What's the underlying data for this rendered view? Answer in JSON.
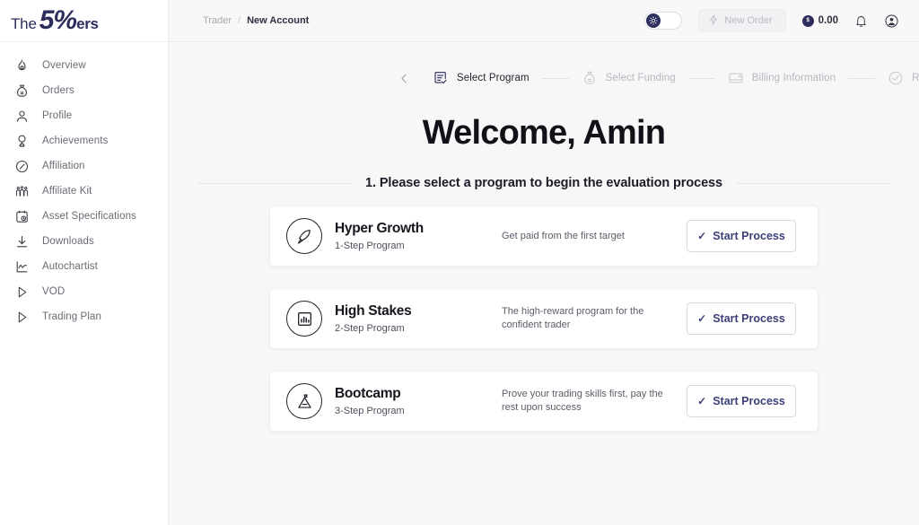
{
  "brand": {
    "logo_the": "The",
    "logo_five": "5%",
    "logo_ers": "ers",
    "navy": "#2b2d5c",
    "accent_button_text": "#3c3f78",
    "page_bg": "#f7f7f8",
    "card_bg": "#ffffff"
  },
  "sidebar": {
    "items": [
      {
        "label": "Overview",
        "icon": "flame-icon"
      },
      {
        "label": "Orders",
        "icon": "money-bag-icon"
      },
      {
        "label": "Profile",
        "icon": "user-icon"
      },
      {
        "label": "Achievements",
        "icon": "trophy-icon"
      },
      {
        "label": "Affiliation",
        "icon": "compass-icon"
      },
      {
        "label": "Affiliate Kit",
        "icon": "people-group-icon"
      },
      {
        "label": "Asset Specifications",
        "icon": "clipboard-clock-icon"
      },
      {
        "label": "Downloads",
        "icon": "download-icon"
      },
      {
        "label": "Autochartist",
        "icon": "chart-line-icon"
      },
      {
        "label": "VOD",
        "icon": "play-triangle-icon"
      },
      {
        "label": "Trading Plan",
        "icon": "play-triangle-icon"
      }
    ]
  },
  "topbar": {
    "breadcrumb_root": "Trader",
    "breadcrumb_separator": "/",
    "breadcrumb_current": "New Account",
    "theme_toggle_state": "light",
    "theme_toggle_icon": "sun-icon",
    "new_order_label": "New Order",
    "new_order_icon": "lightning-bolt-icon",
    "new_order_disabled": "true",
    "balance_icon": "coin-icon",
    "balance_icon_text": "$",
    "balance_amount": "0.00",
    "notifications_icon": "bell-icon",
    "account_icon": "user-circle-icon"
  },
  "stepper": {
    "back_icon": "chevron-left-icon",
    "steps": [
      {
        "label": "Select Program",
        "icon": "document-check-icon",
        "state": "active"
      },
      {
        "label": "Select Funding",
        "icon": "money-bag-icon",
        "state": "inactive"
      },
      {
        "label": "Billing Information",
        "icon": "credit-card-icon",
        "state": "inactive"
      },
      {
        "label": "Review and Pay",
        "icon": "check-circle-icon",
        "state": "inactive"
      }
    ]
  },
  "hero": {
    "welcome": "Welcome, Amin",
    "subtitle": "1. Please select a program to begin the evaluation process"
  },
  "programs": [
    {
      "title": "Hyper Growth",
      "steps": "1-Step Program",
      "description": "Get paid from the first target",
      "icon": "rocket-icon",
      "button_label": "Start Process",
      "button_icon": "check-icon"
    },
    {
      "title": "High Stakes",
      "steps": "2-Step Program",
      "description": "The high-reward program for the confident trader",
      "icon": "bar-chart-icon",
      "button_label": "Start Process",
      "button_icon": "check-icon"
    },
    {
      "title": "Bootcamp",
      "steps": "3-Step Program",
      "description": "Prove your trading skills first, pay the rest upon success",
      "icon": "mountain-flag-icon",
      "button_label": "Start Process",
      "button_icon": "check-icon"
    }
  ]
}
